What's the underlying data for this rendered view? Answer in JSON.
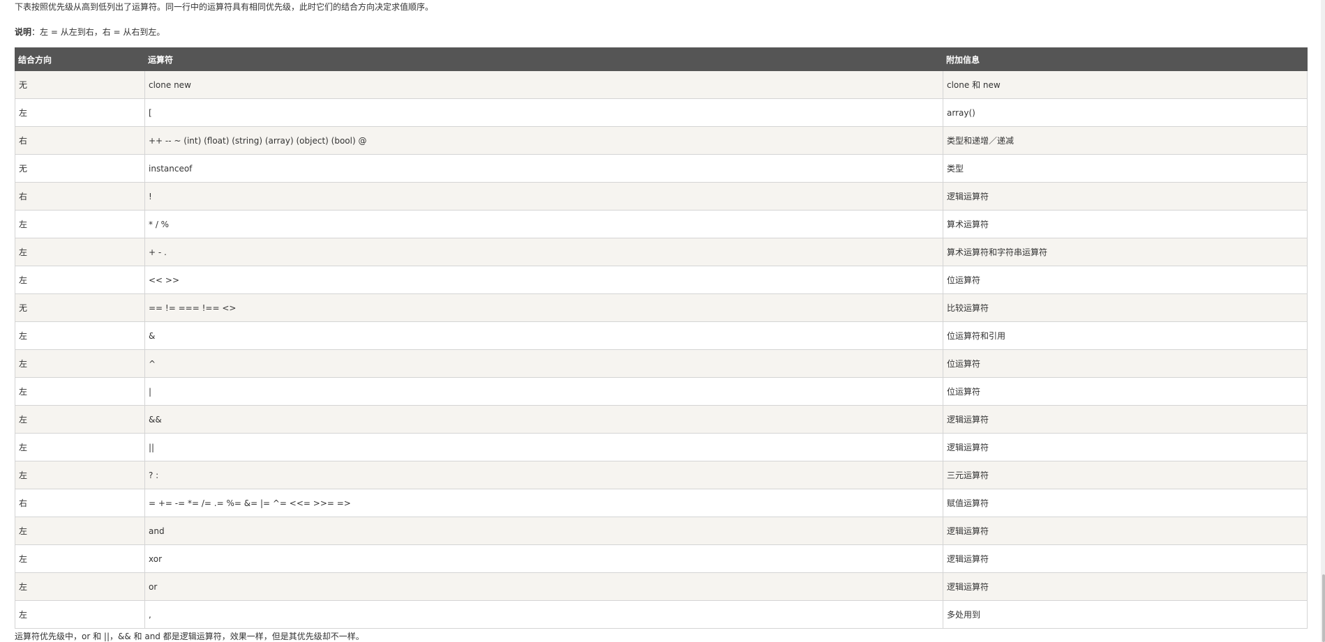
{
  "intro": {
    "line1": "下表按照优先级从高到低列出了运算符。同一行中的运算符具有相同优先级，此时它们的结合方向决定求值顺序。",
    "note_label": "说明",
    "note_text": "：左 = 从左到右，右 = 从右到左。"
  },
  "table": {
    "headers": {
      "assoc": "结合方向",
      "operator": "运算符",
      "info": "附加信息"
    },
    "rows": [
      {
        "assoc": "无",
        "operator": "clone new",
        "info": "clone 和 new"
      },
      {
        "assoc": "左",
        "operator": "[",
        "info": "array()"
      },
      {
        "assoc": "右",
        "operator": "++ -- ~ (int) (float) (string) (array) (object) (bool) @",
        "info": "类型和递增／递减"
      },
      {
        "assoc": "无",
        "operator": "instanceof",
        "info": "类型"
      },
      {
        "assoc": "右",
        "operator": "!",
        "info": "逻辑运算符"
      },
      {
        "assoc": "左",
        "operator": "* / %",
        "info": "算术运算符"
      },
      {
        "assoc": "左",
        "operator": "+ - .",
        "info": "算术运算符和字符串运算符"
      },
      {
        "assoc": "左",
        "operator": "<< >>",
        "info": "位运算符"
      },
      {
        "assoc": "无",
        "operator": "== != === !== <>",
        "info": "比较运算符"
      },
      {
        "assoc": "左",
        "operator": "&",
        "info": "位运算符和引用"
      },
      {
        "assoc": "左",
        "operator": "^",
        "info": "位运算符"
      },
      {
        "assoc": "左",
        "operator": "|",
        "info": "位运算符"
      },
      {
        "assoc": "左",
        "operator": "&&",
        "info": "逻辑运算符"
      },
      {
        "assoc": "左",
        "operator": "||",
        "info": "逻辑运算符"
      },
      {
        "assoc": "左",
        "operator": "? :",
        "info": "三元运算符"
      },
      {
        "assoc": "右",
        "operator": "= += -= *= /= .= %= &= |= ^= <<= >>= =>",
        "info": "赋值运算符"
      },
      {
        "assoc": "左",
        "operator": "and",
        "info": "逻辑运算符"
      },
      {
        "assoc": "左",
        "operator": "xor",
        "info": "逻辑运算符"
      },
      {
        "assoc": "左",
        "operator": "or",
        "info": "逻辑运算符"
      },
      {
        "assoc": "左",
        "operator": ",",
        "info": "多处用到"
      }
    ]
  },
  "footnote": "运算符优先级中，or 和 ||，&& 和 and 都是逻辑运算符，效果一样，但是其优先级却不一样。",
  "colors": {
    "header_bg": "#555555",
    "header_text": "#ffffff",
    "row_odd_bg": "#f6f4f0",
    "row_even_bg": "#ffffff",
    "border": "#d4d4d4"
  }
}
